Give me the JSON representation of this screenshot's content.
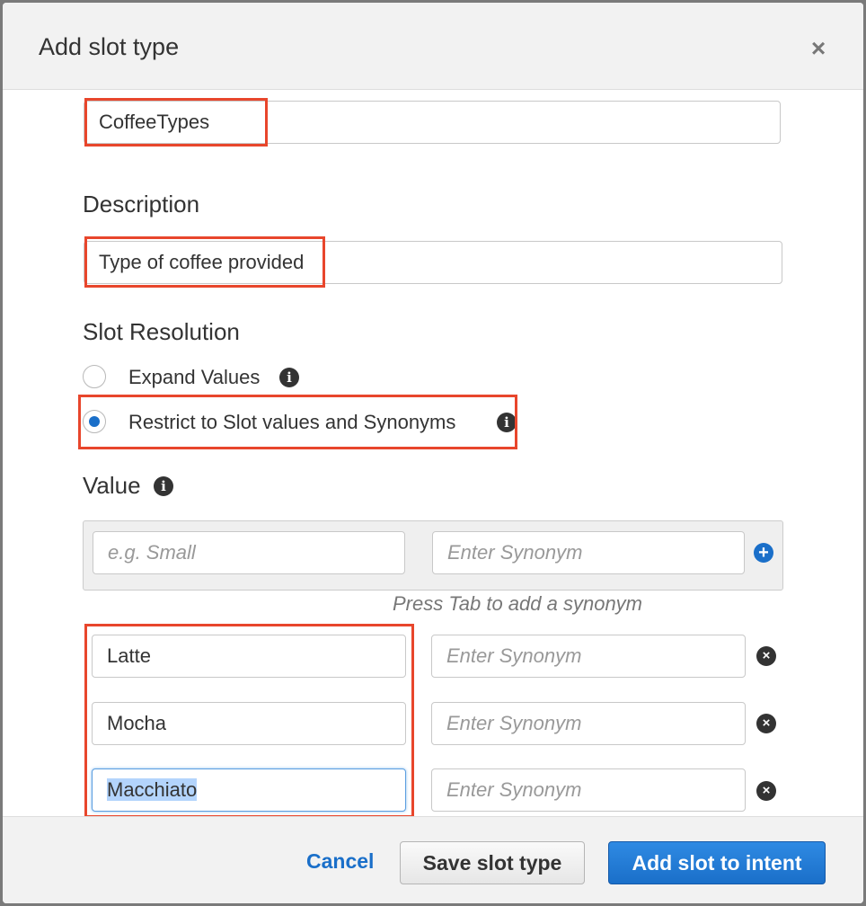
{
  "modal": {
    "title": "Add slot type",
    "close_glyph": "×"
  },
  "form": {
    "name_value": "CoffeeTypes",
    "description_label": "Description",
    "description_value": "Type of coffee provided",
    "slot_resolution_label": "Slot Resolution",
    "resolution_options": [
      {
        "label": "Expand Values",
        "checked": false
      },
      {
        "label": "Restrict to Slot values and Synonyms",
        "checked": true
      }
    ],
    "value_label": "Value",
    "new_value_placeholder": "e.g. Small",
    "synonym_placeholder": "Enter Synonym",
    "hint": "Press Tab to add a synonym",
    "values": [
      {
        "value": "Latte"
      },
      {
        "value": "Mocha"
      },
      {
        "value": "Macchiato"
      }
    ]
  },
  "footer": {
    "cancel_label": "Cancel",
    "save_label": "Save slot type",
    "add_label": "Add slot to intent"
  },
  "colors": {
    "highlight_border": "#e8462c",
    "accent": "#1a6fc9"
  },
  "icons": {
    "info": "info-icon",
    "add": "plus-circle-icon",
    "remove": "close-circle-icon",
    "close": "close-icon"
  }
}
